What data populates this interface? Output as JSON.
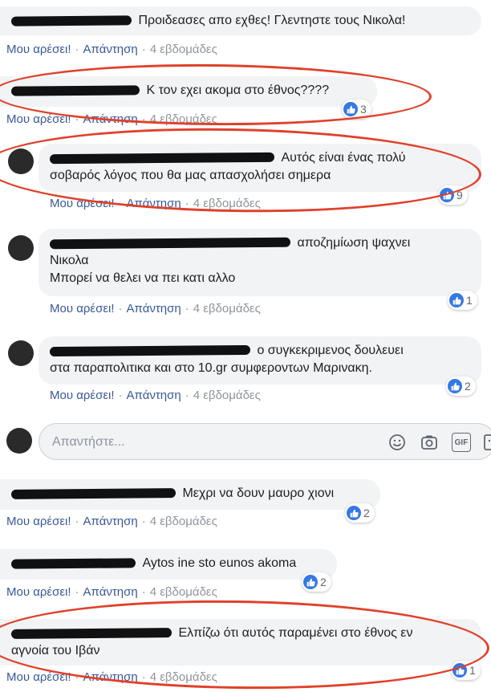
{
  "comments": [
    {
      "text": "Προιδεασες απο εχθες! Γλεντηστε τους Νικολα!",
      "like": "Μου αρέσει!",
      "reply": "Απάντηση",
      "time": "4 εβδομάδες",
      "reactions": ""
    },
    {
      "text": "Κ τον εχει ακομα στο έθνος????",
      "like": "Μου αρέσει!",
      "reply": "Απάντηση",
      "time": "4 εβδομάδες",
      "reactions": "3"
    },
    {
      "text_line1": "Αυτός είναι ένας πολύ",
      "text_line2": "σοβαρός λόγος που θα μας απασχολήσει σημερα",
      "like": "Μου αρέσει!",
      "reply": "Απάντηση",
      "time": "4 εβδομάδες",
      "reactions": "9"
    },
    {
      "text_line1": "αποζημίωση ψαχνει",
      "text_line2": "Νικολα",
      "text_line3": "Μπορεί να θελει να πει κατι αλλο",
      "like": "Μου αρέσει!",
      "reply": "Απάντηση",
      "time": "4 εβδομάδες",
      "reactions": "1"
    },
    {
      "text_line1": "ο συγκεκριμενος δουλευει",
      "text_line2": "στα παραπολιτικα και στο 10.gr συμφεροντων Μαρινακη.",
      "like": "Μου αρέσει!",
      "reply": "Απάντηση",
      "time": "4 εβδομάδες",
      "reactions": "2"
    },
    {
      "text": "Μεχρι να δουν μαυρο χιονι",
      "like": "Μου αρέσει!",
      "reply": "Απάντηση",
      "time": "4 εβδομάδες",
      "reactions": "2"
    },
    {
      "text": "Aytos ine sto eunos akoma",
      "like": "Μου αρέσει!",
      "reply": "Απάντηση",
      "time": "4 εβδομάδες",
      "reactions": "2"
    },
    {
      "text_line1": "Ελπίζω ότι αυτός παραμένει στο έθνος εν",
      "text_line2": "αγνοία του Ιβάν",
      "like": "Μου αρέσει!",
      "reply": "Απάντηση",
      "time": "4 εβδομάδες",
      "reactions": "1"
    }
  ],
  "reply_box": {
    "placeholder": "Απαντήστε...",
    "gif_label": "GIF"
  },
  "colors": {
    "link": "#385898",
    "like_blue": "#3578e5",
    "highlight_red": "#e0412c",
    "bubble_bg": "#f2f3f5"
  },
  "icons": [
    "like-icon",
    "emoji-icon",
    "camera-icon",
    "gif-icon",
    "sticker-icon"
  ]
}
